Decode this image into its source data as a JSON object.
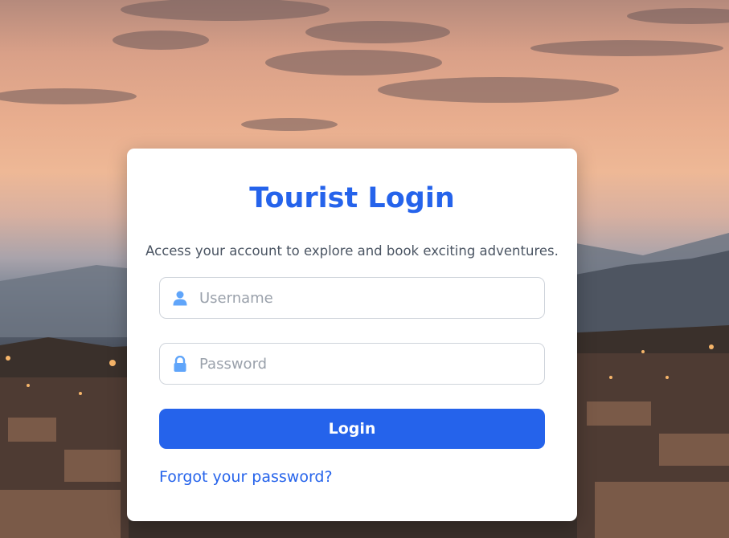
{
  "login": {
    "title": "Tourist Login",
    "subtitle": "Access your account to explore and book exciting adventures.",
    "username_placeholder": "Username",
    "password_placeholder": "Password",
    "login_label": "Login",
    "forgot_label": "Forgot your password?"
  },
  "icons": {
    "username": "user-icon",
    "password": "lock-icon"
  },
  "colors": {
    "accent": "#2563eb",
    "card_bg": "#ffffff",
    "input_border": "#cfd4db",
    "placeholder": "#9aa1ab",
    "subtitle_text": "#4b5563"
  }
}
